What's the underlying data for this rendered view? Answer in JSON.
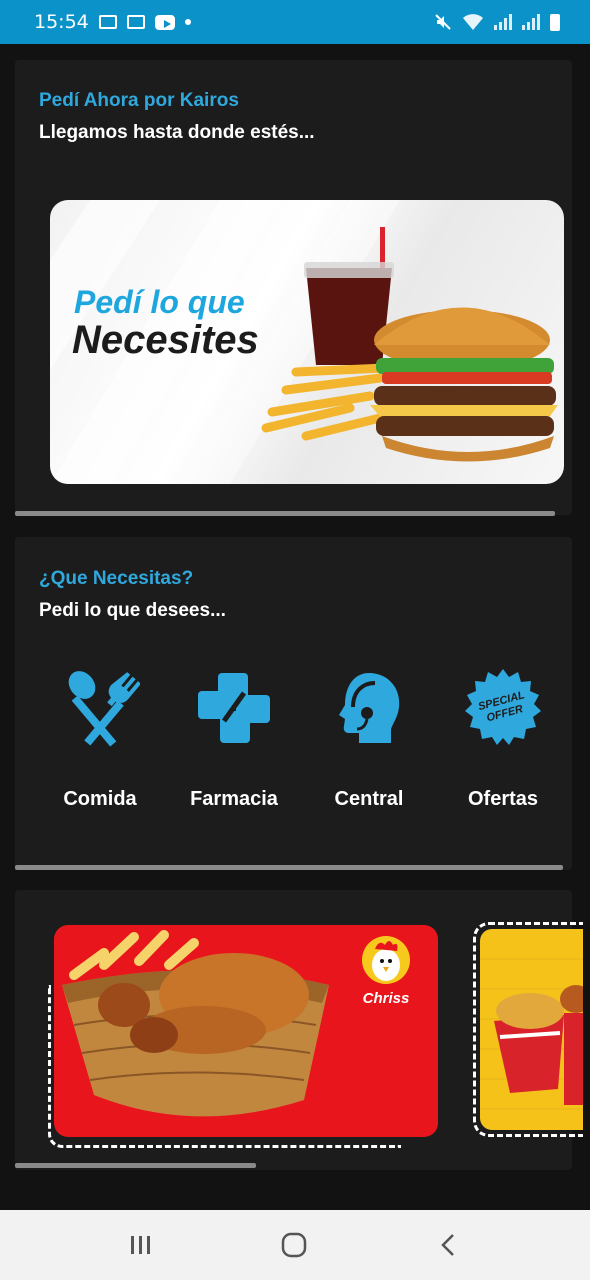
{
  "status_bar": {
    "time": "15:54",
    "icons": [
      "image-icon",
      "laptop-icon",
      "youtube-icon",
      "notification-dot",
      "mute-icon",
      "wifi-icon",
      "signal-icon",
      "signal-icon",
      "battery-icon"
    ]
  },
  "section_order": {
    "title": "Pedí Ahora por Kairos",
    "subtitle": "Llegamos hasta donde estés..."
  },
  "banner": {
    "line1": "Pedí lo que",
    "line2": "Necesites",
    "image": "burger-fries-soda"
  },
  "section_needs": {
    "title": "¿Que Necesitas?",
    "subtitle": "Pedi lo que desees...",
    "categories": [
      {
        "label": "Comida",
        "icon": "spoon-fork-icon"
      },
      {
        "label": "Farmacia",
        "icon": "pharmacy-cross-icon"
      },
      {
        "label": "Central",
        "icon": "support-headset-icon"
      },
      {
        "label": "Ofertas",
        "icon": "special-offer-icon"
      }
    ],
    "offer_badge": "SPECIAL OFFER"
  },
  "promos": {
    "main_brand": "Chriss",
    "main_image": "fried-chicken-basket",
    "side_image": "fries-chicken-cup"
  },
  "colors": {
    "accent": "#2fa8dd",
    "status_bar": "#0b93c9",
    "background": "#121212",
    "card": "#1c1c1d",
    "promo_red": "#e8161c"
  },
  "nav": [
    "recent-apps-icon",
    "home-icon",
    "back-icon"
  ]
}
